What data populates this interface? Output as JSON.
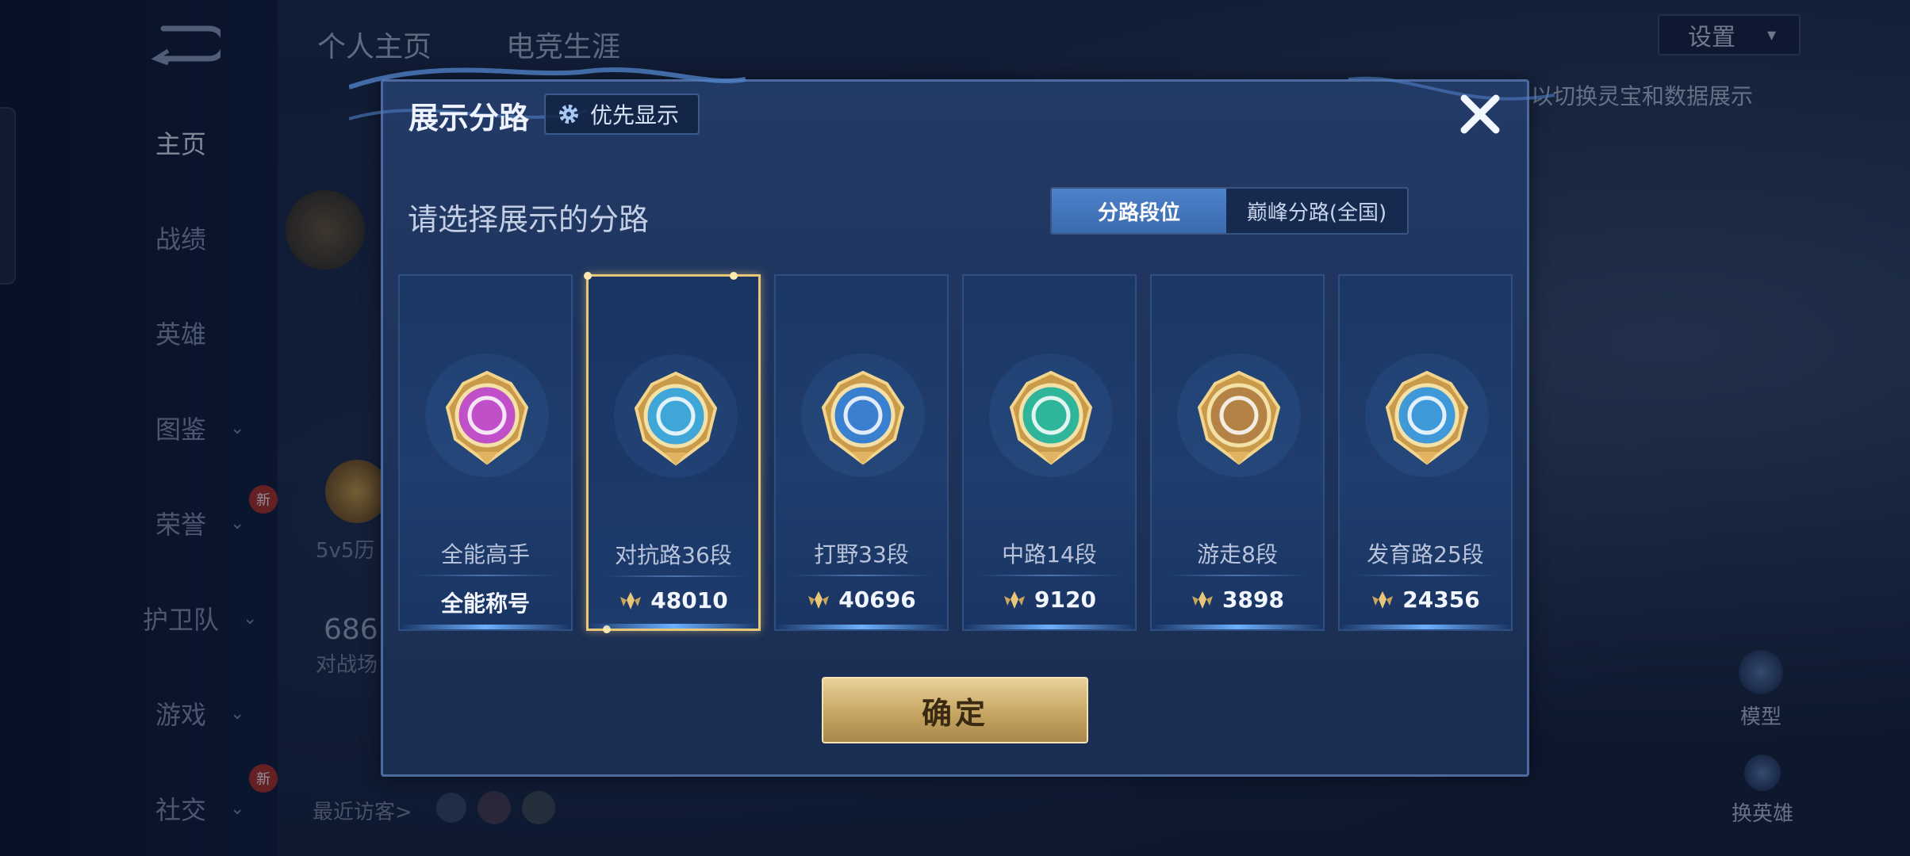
{
  "sidebar": {
    "items": [
      {
        "label": "主页",
        "active": true
      },
      {
        "label": "战绩"
      },
      {
        "label": "英雄"
      },
      {
        "label": "图鉴",
        "chevron": true
      },
      {
        "label": "荣誉",
        "chevron": true,
        "badge": "新"
      },
      {
        "label": "护卫队",
        "chevron": true
      },
      {
        "label": "游戏",
        "chevron": true
      },
      {
        "label": "社交",
        "chevron": true,
        "badge": "新"
      }
    ]
  },
  "background": {
    "tabs": [
      "个人主页",
      "电竞生涯"
    ],
    "settings_label": "设置",
    "hint_text": "以切换灵宝和数据展示",
    "stat_label": "5v5历",
    "stat_value": "686",
    "stat_caption": "对战场",
    "recent_visitors": "最近访客>",
    "model_label": "模型",
    "switch_hero_label": "换英雄"
  },
  "dialog": {
    "title": "展示分路",
    "priority_label": "优先显示",
    "prompt": "请选择展示的分路",
    "segments": [
      "分路段位",
      "巅峰分路(全国)"
    ],
    "active_segment": 0,
    "confirm_label": "确定",
    "cards": [
      {
        "lane": "全能高手",
        "score": "全能称号",
        "has_points_icon": false,
        "selected": false,
        "color": "#c04fc8"
      },
      {
        "lane": "对抗路36段",
        "score": "48010",
        "has_points_icon": true,
        "selected": true,
        "color": "#3ea7d8"
      },
      {
        "lane": "打野33段",
        "score": "40696",
        "has_points_icon": true,
        "selected": false,
        "color": "#3b7fd0"
      },
      {
        "lane": "中路14段",
        "score": "9120",
        "has_points_icon": true,
        "selected": false,
        "color": "#2fb59a"
      },
      {
        "lane": "游走8段",
        "score": "3898",
        "has_points_icon": true,
        "selected": false,
        "color": "#b58246"
      },
      {
        "lane": "发育路25段",
        "score": "24356",
        "has_points_icon": true,
        "selected": false,
        "color": "#3f98d8"
      }
    ]
  },
  "colors": {
    "dialog_bg": "#1d3259",
    "selected_border": "#e9c778",
    "confirm_gold": "#c7a663",
    "segment_active": "#4d82c9"
  },
  "icons": [
    "back-icon",
    "gear-icon",
    "close-icon",
    "points-icon",
    "chevron-down-icon"
  ]
}
